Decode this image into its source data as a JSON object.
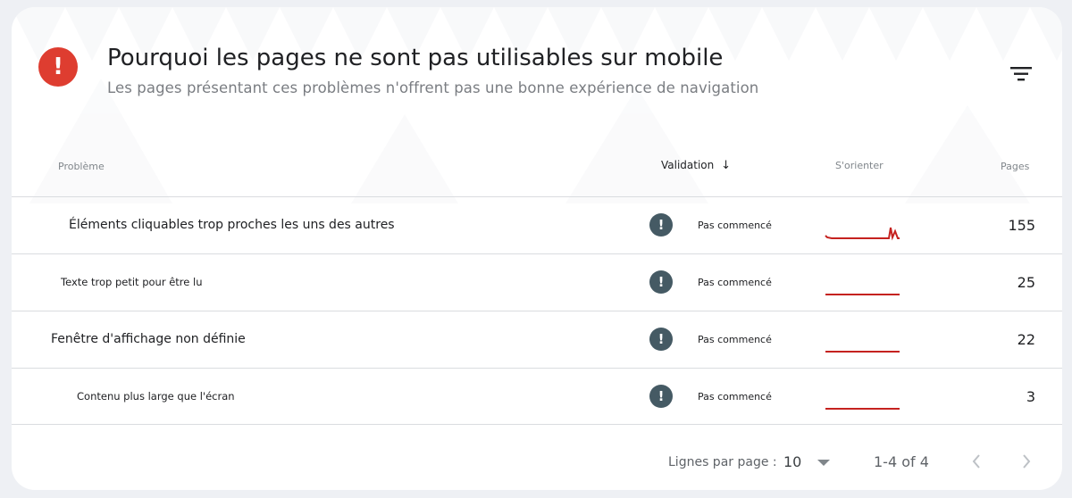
{
  "header": {
    "icon": "error-icon",
    "icon_color": "#de3d30",
    "title": "Pourquoi les pages ne sont pas utilisables sur mobile",
    "subtitle": "Les pages présentant ces problèmes n'offrent pas une bonne expérience de navigation",
    "filter_icon": "filter-icon"
  },
  "table": {
    "columns": {
      "problem": "Problème",
      "validation": "Validation",
      "sort_indicator": "↓",
      "trend": "S'orienter",
      "pages": "Pages"
    },
    "rows": [
      {
        "label": "Éléments cliquables trop proches les uns des autres",
        "status": "Pas commencé",
        "pages": "155",
        "trend": "spike"
      },
      {
        "label": "Texte trop petit pour être lu",
        "status": "Pas commencé",
        "pages": "25",
        "trend": "flat"
      },
      {
        "label": "Fenêtre d'affichage non définie",
        "status": "Pas commencé",
        "pages": "22",
        "trend": "flat"
      },
      {
        "label": "Contenu plus large que l'écran",
        "status": "Pas commencé",
        "pages": "3",
        "trend": "flat"
      }
    ],
    "status_icon_color": "#455a64",
    "trend_color": "#c5221f"
  },
  "footer": {
    "rows_per_page_label": "Lignes par page :",
    "rows_per_page_value": "10",
    "range": "1-4 of 4",
    "prev_icon": "chevron-left-icon",
    "next_icon": "chevron-right-icon"
  }
}
